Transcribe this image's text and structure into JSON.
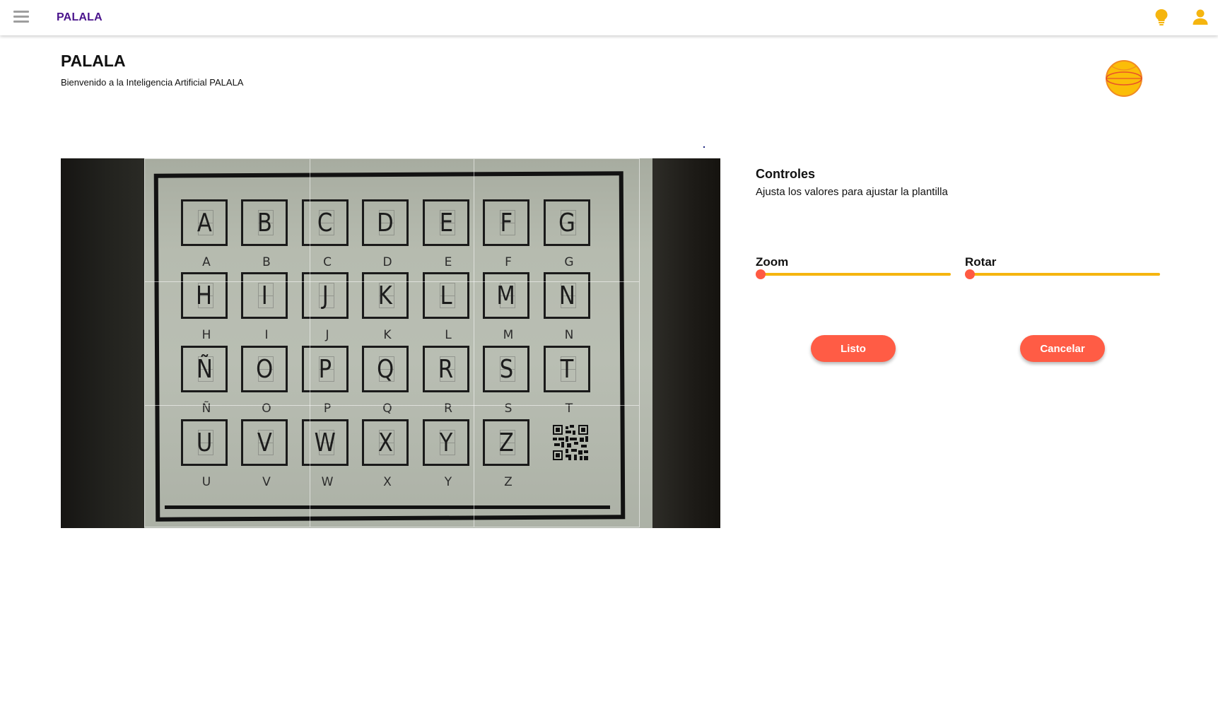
{
  "topbar": {
    "brand": "PALALA",
    "menu_icon": "hamburger-menu-icon",
    "tips_icon": "lightbulb-icon",
    "account_icon": "user-icon",
    "accent_color": "#f5b50f",
    "brand_color": "#4a148c"
  },
  "header": {
    "title": "PALALA",
    "subtitle": "Bienvenido a la Inteligencia Artificial PALALA",
    "logo_icon": "palala-ball-logo"
  },
  "capture": {
    "letters": [
      {
        "glyph": "A",
        "label": "A"
      },
      {
        "glyph": "B",
        "label": "B"
      },
      {
        "glyph": "C",
        "label": "C"
      },
      {
        "glyph": "D",
        "label": "D"
      },
      {
        "glyph": "E",
        "label": "E"
      },
      {
        "glyph": "F",
        "label": "F"
      },
      {
        "glyph": "G",
        "label": "G"
      },
      {
        "glyph": "H",
        "label": "H"
      },
      {
        "glyph": "I",
        "label": "I"
      },
      {
        "glyph": "J",
        "label": "J"
      },
      {
        "glyph": "K",
        "label": "K"
      },
      {
        "glyph": "L",
        "label": "L"
      },
      {
        "glyph": "M",
        "label": "M"
      },
      {
        "glyph": "N",
        "label": "N"
      },
      {
        "glyph": "Ñ",
        "label": "Ñ"
      },
      {
        "glyph": "O",
        "label": "O"
      },
      {
        "glyph": "P",
        "label": "P"
      },
      {
        "glyph": "Q",
        "label": "Q"
      },
      {
        "glyph": "R",
        "label": "R"
      },
      {
        "glyph": "S",
        "label": "S"
      },
      {
        "glyph": "T",
        "label": "T"
      },
      {
        "glyph": "U",
        "label": "U"
      },
      {
        "glyph": "V",
        "label": "V"
      },
      {
        "glyph": "W",
        "label": "W"
      },
      {
        "glyph": "X",
        "label": "X"
      },
      {
        "glyph": "Y",
        "label": "Y"
      },
      {
        "glyph": "Z",
        "label": "Z"
      }
    ],
    "qr_icon": "qr-code-icon"
  },
  "controls": {
    "title": "Controles",
    "description": "Ajusta los valores para ajustar la plantilla",
    "zoom": {
      "label": "Zoom",
      "value": 0
    },
    "rotate": {
      "label": "Rotar",
      "value": 0
    },
    "slider_color": "#f5b50f",
    "thumb_color": "#ff5a42"
  },
  "actions": {
    "done_label": "Listo",
    "cancel_label": "Cancelar",
    "button_color": "#ff5c45"
  }
}
